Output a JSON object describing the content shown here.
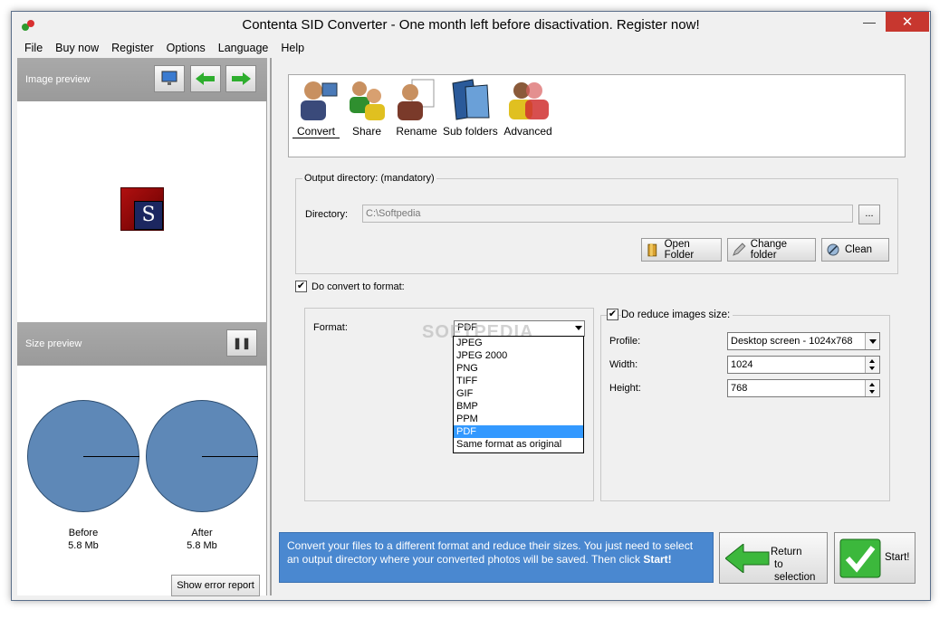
{
  "window": {
    "title": "Contenta SID Converter  - One month left before disactivation. Register now!",
    "controls": {
      "minimize": "—",
      "maximize": "☐",
      "close": "✕"
    }
  },
  "menu": [
    "File",
    "Buy now",
    "Register",
    "Options",
    "Language",
    "Help"
  ],
  "left": {
    "image_preview_label": "Image preview",
    "size_preview_label": "Size preview",
    "before_label": "Before",
    "before_size": "5.8 Mb",
    "after_label": "After",
    "after_size": "5.8 Mb",
    "error_button": "Show error report",
    "preview_letter": "S"
  },
  "toolbar": {
    "items": [
      {
        "label": "Convert"
      },
      {
        "label": "Share"
      },
      {
        "label": "Rename"
      },
      {
        "label": "Sub folders"
      },
      {
        "label": "Advanced"
      }
    ]
  },
  "output": {
    "legend": "Output directory: (mandatory)",
    "dir_label": "Directory:",
    "dir_value": "C:\\Softpedia",
    "browse": "...",
    "open_folder": "Open Folder",
    "change_folder": "Change folder",
    "clean": "Clean"
  },
  "convert": {
    "checkbox_label": "Do convert to format:",
    "checked": true,
    "format_label": "Format:",
    "format_value": "PDF",
    "options": [
      "JPEG",
      "JPEG 2000",
      "PNG",
      "TIFF",
      "GIF",
      "BMP",
      "PPM",
      "PDF",
      "Same format as original"
    ],
    "selected_option": "PDF",
    "watermark": "SOFTPEDIA"
  },
  "reduce": {
    "checkbox_label": "Do reduce images size:",
    "checked": true,
    "profile_label": "Profile:",
    "profile_value": "Desktop screen - 1024x768",
    "width_label": "Width:",
    "width_value": "1024",
    "height_label": "Height:",
    "height_value": "768"
  },
  "bottom": {
    "info_text": "Convert your files to a different format and reduce their sizes. You just need to select an output directory where your converted photos will be saved. Then click ",
    "info_bold": "Start!",
    "return_label_1": "Return",
    "return_label_2": "to selection",
    "start_label": "Start!"
  },
  "colors": {
    "accent": "#4a88d0",
    "pie": "#5e88b7",
    "selection": "#3399ff",
    "close": "#c7372f"
  }
}
